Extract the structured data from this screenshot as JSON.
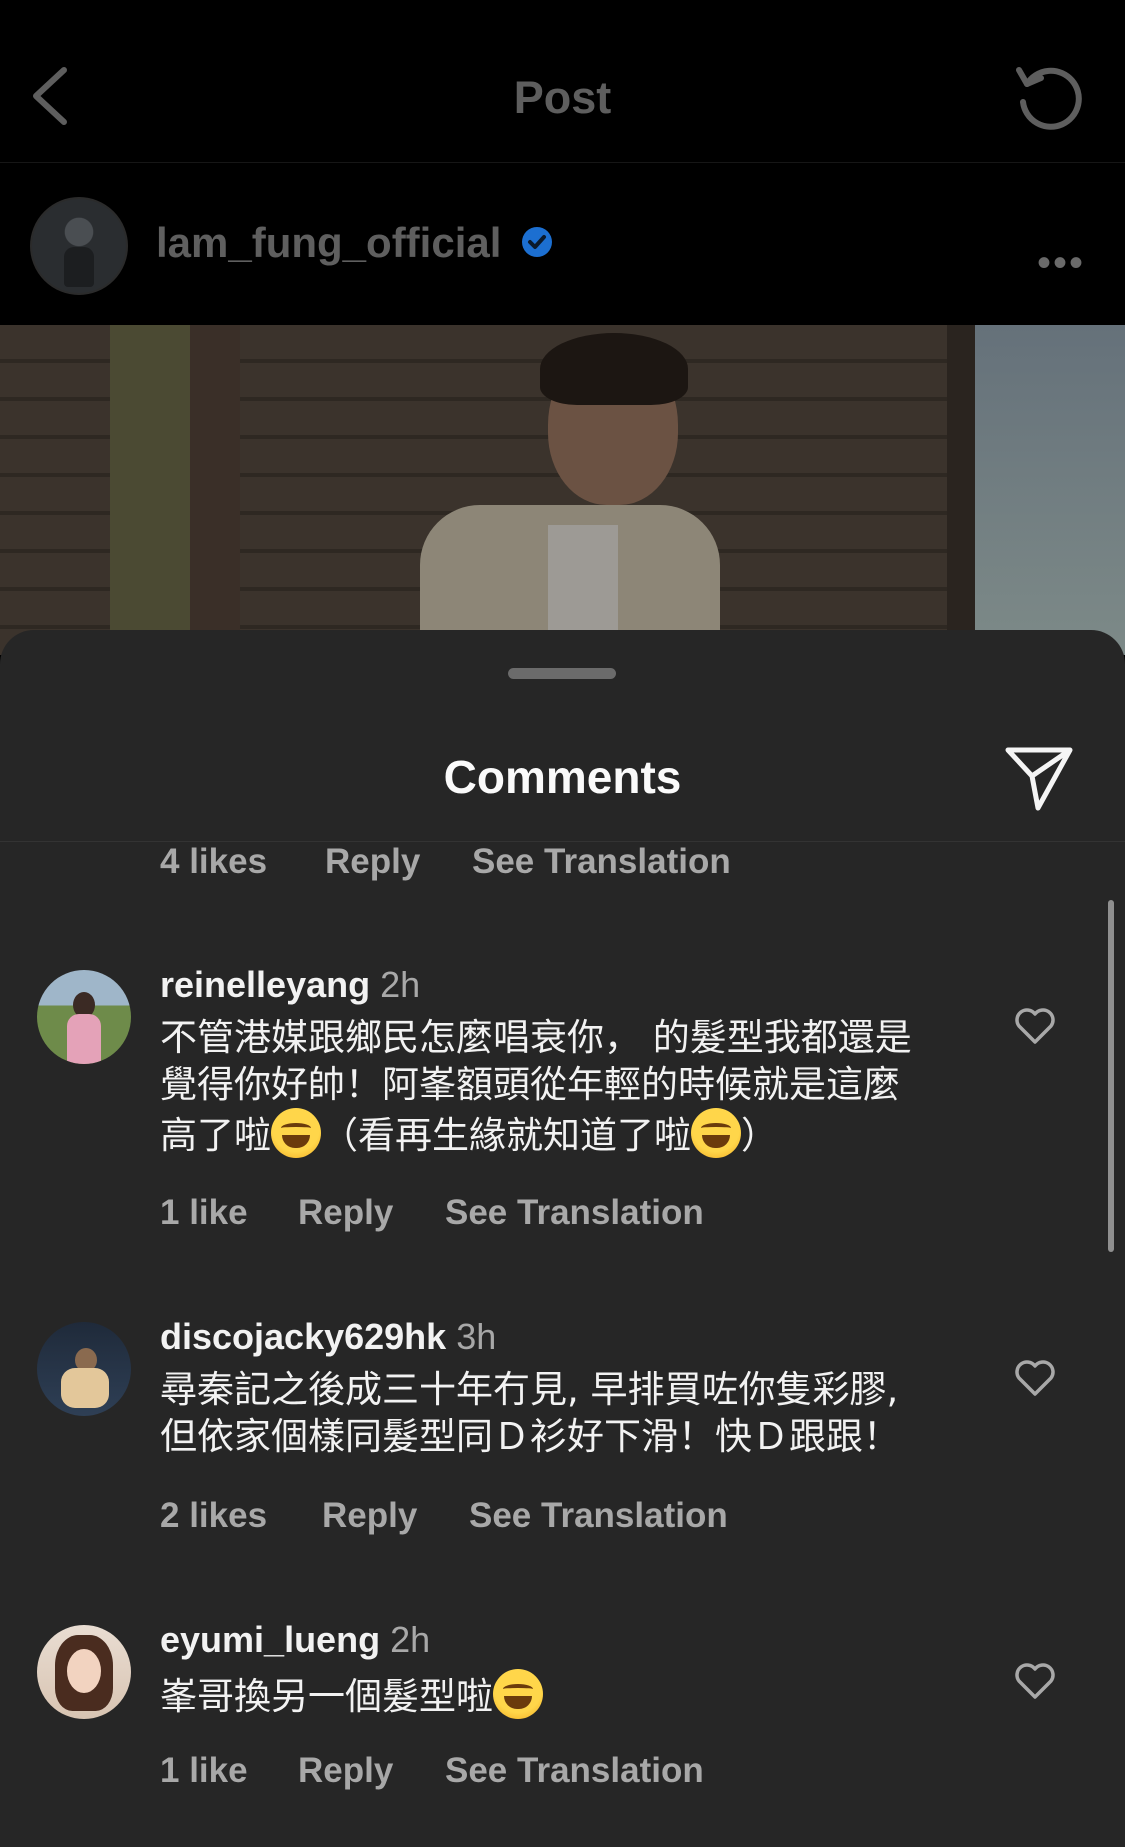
{
  "header": {
    "title": "Post"
  },
  "author": {
    "username": "lam_fung_official"
  },
  "sheet": {
    "title": "Comments"
  },
  "first_meta": {
    "likes": "4 likes",
    "reply": "Reply",
    "translate": "See Translation"
  },
  "comments": [
    {
      "username": "reinelleyang",
      "time": "2h",
      "text_lines": [
        "不管港媒跟鄉民怎麼唱衰你， 的髮型我都還是",
        "覺得你好帥！阿峯額頭從年輕的時候就是這麼"
      ],
      "line3_a": "高了啦",
      "line3_b": "（看再生緣就知道了啦",
      "line3_c": "）",
      "likes": "1 like",
      "reply": "Reply",
      "translate": "See Translation"
    },
    {
      "username": "discojacky629hk",
      "time": "3h",
      "text_lines": [
        "尋秦記之後成三十年冇見, 早排買咗你隻彩膠,",
        "但依家個樣同髮型同Ｄ衫好下滑！快Ｄ跟跟！"
      ],
      "likes": "2 likes",
      "reply": "Reply",
      "translate": "See Translation"
    },
    {
      "username": "eyumi_lueng",
      "time": "2h",
      "text_a": "峯哥換另一個髮型啦",
      "likes": "1 like",
      "reply": "Reply",
      "translate": "See Translation"
    }
  ],
  "icons": [
    "back-chevron-icon",
    "refresh-icon",
    "verified-badge-icon",
    "more-options-icon",
    "share-send-icon",
    "heart-icon",
    "emoji-laughing-icon"
  ]
}
